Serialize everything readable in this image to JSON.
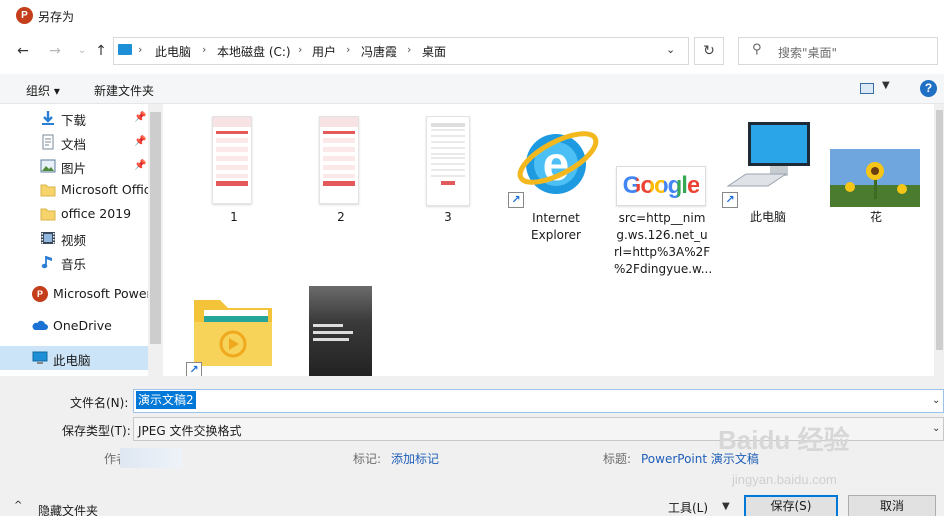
{
  "window": {
    "title": "另存为",
    "app_icon_letter": "P"
  },
  "address": {
    "crumbs": [
      "此电脑",
      "本地磁盘 (C:)",
      "用户",
      "冯唐霞",
      "桌面"
    ],
    "search_placeholder": "搜索\"桌面\""
  },
  "toolbar": {
    "organize": "组织 ▾",
    "new_folder": "新建文件夹",
    "help": "?"
  },
  "nav": {
    "items": [
      {
        "label": "下载",
        "pinned": true
      },
      {
        "label": "文档",
        "pinned": true
      },
      {
        "label": "图片",
        "pinned": true
      },
      {
        "label": "Microsoft Office"
      },
      {
        "label": "office 2019"
      },
      {
        "label": "视频"
      },
      {
        "label": "音乐"
      },
      {
        "label": "Microsoft PowerPoint"
      },
      {
        "label": "OneDrive"
      },
      {
        "label": "此电脑"
      }
    ]
  },
  "files": [
    {
      "label": "1"
    },
    {
      "label": "2"
    },
    {
      "label": "3"
    },
    {
      "label": "Internet\nExplorer"
    },
    {
      "label": "src=http__nim\ng.ws.126.net_u\nrl=http%3A%2F\n%2Fdingyue.w..."
    },
    {
      "label": "此电脑"
    },
    {
      "label": "花"
    },
    {
      "label": ""
    },
    {
      "label": ""
    }
  ],
  "google_logo_text": "Google",
  "form": {
    "filename_label": "文件名(N):",
    "filename_value": "演示文稿2",
    "type_label": "保存类型(T):",
    "type_value": "JPEG 文件交换格式",
    "author_label": "作者:",
    "tags_label": "标记:",
    "tags_link": "添加标记",
    "title_label": "标题:",
    "title_link": "PowerPoint 演示文稿"
  },
  "footer": {
    "hide_folders": "隐藏文件夹",
    "tools": "工具(L)",
    "save": "保存(S)",
    "cancel": "取消"
  },
  "watermark": {
    "main": "Baidu 经验",
    "sub": "jingyan.baidu.com"
  },
  "colors": {
    "accent": "#0078d7",
    "nav_selected": "#cce4f7",
    "link": "#1f5fb8"
  }
}
